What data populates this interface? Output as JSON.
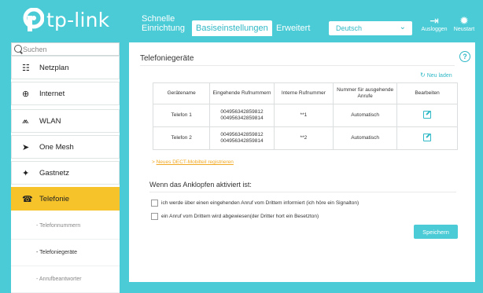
{
  "brand": {
    "logo_text": "tp-link",
    "accent": "#4acbd6",
    "highlight": "#f6c32a"
  },
  "header": {
    "tabs": [
      {
        "label": "Schnelle Einrichtung",
        "active": false
      },
      {
        "label": "Basiseinstellungen",
        "active": true
      },
      {
        "label": "Erweitert",
        "active": false
      }
    ],
    "language": "Deutsch",
    "logout_label": "Ausloggen",
    "restart_label": "Neustart"
  },
  "sidebar": {
    "search_placeholder": "Suchen",
    "items": [
      {
        "label": "Netzplan",
        "icon": "network-map-icon"
      },
      {
        "label": "Internet",
        "icon": "globe-icon"
      },
      {
        "label": "WLAN",
        "icon": "wifi-icon"
      },
      {
        "label": "One Mesh",
        "icon": "mesh-icon"
      },
      {
        "label": "Gastnetz",
        "icon": "guest-network-icon"
      },
      {
        "label": "Telefonie",
        "icon": "phone-icon",
        "active": true
      }
    ],
    "subitems": [
      {
        "label": "- Telefonnummern",
        "active": false
      },
      {
        "label": "- Telefoniegeräte",
        "active": true
      },
      {
        "label": "- Anrufbeantworter",
        "active": false
      }
    ]
  },
  "main": {
    "section_title": "Telefoniegeräte",
    "reload_label": "Neu laden",
    "table": {
      "headers": [
        "Gerätename",
        "Eingehende Rufnummern",
        "Interne Rufnummer",
        "Nummer für ausgehende Anrufe",
        "Bearbeiten"
      ],
      "rows": [
        {
          "name": "Telefon 1",
          "incoming_1": "004956342859812",
          "incoming_2": "004956342859814",
          "internal": "**1",
          "outgoing": "Automatisch"
        },
        {
          "name": "Telefon 2",
          "incoming_1": "004956342859812",
          "incoming_2": "004956342859814",
          "internal": "**2",
          "outgoing": "Automatisch"
        }
      ]
    },
    "dect_link": "Neues DECT-Mobilteil registrieren",
    "call_waiting_title": "Wenn das Anklopfen aktiviert ist:",
    "options": [
      {
        "label": "ich werde über einen eingehenden Anruf vom Drittem informiert (ich höre ein Signalton)",
        "checked": false
      },
      {
        "label": "ein Anruf vom Drittem wird abgewiesen(der Dritter hort ein Besetzton)",
        "checked": false
      }
    ],
    "save_label": "Speichern"
  }
}
